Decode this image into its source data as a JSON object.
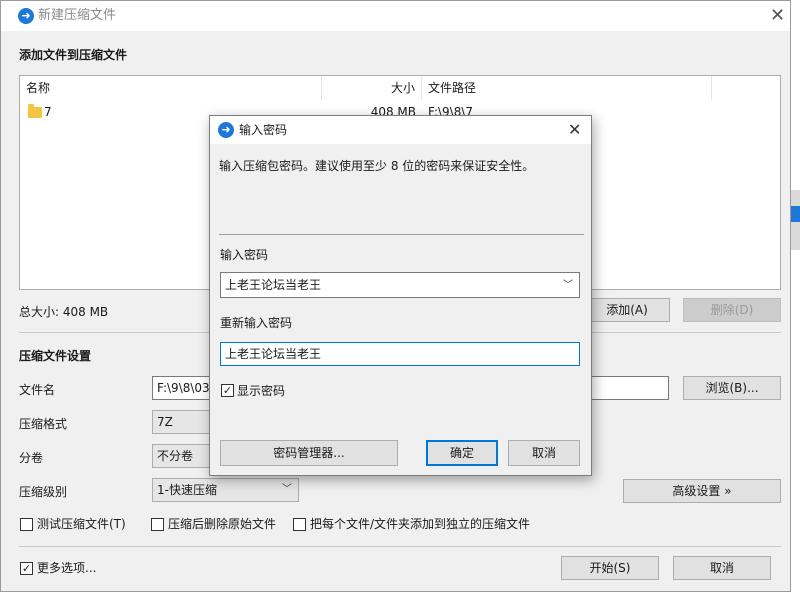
{
  "main": {
    "title": "新建压缩文件",
    "add_section_title": "添加文件到压缩文件",
    "columns": [
      "名称",
      "大小",
      "文件路径"
    ],
    "rows": [
      {
        "name": "7",
        "size": "408 MB",
        "path": "F:\\9\\8\\7"
      }
    ],
    "total_size": "总大小: 408 MB",
    "add_button": "添加(A)",
    "delete_button": "删除(D)",
    "settings_title": "压缩文件设置",
    "filename_label": "文件名",
    "filename_value": "F:\\9\\8\\03",
    "browse_button": "浏览(B)...",
    "format_label": "压缩格式",
    "format_value": "7Z",
    "split_label": "分卷",
    "split_value": "不分卷",
    "level_label": "压缩级别",
    "level_value": "1-快速压缩",
    "advanced_button": "高级设置 »",
    "checkboxes": [
      {
        "label": "测试压缩文件(T)",
        "checked": false
      },
      {
        "label": "压缩后删除原始文件",
        "checked": false
      },
      {
        "label": "把每个文件/文件夹添加到独立的压缩文件",
        "checked": false
      }
    ],
    "more_options": {
      "label": "更多选项...",
      "checked": true
    },
    "start_button": "开始(S)",
    "cancel_button": "取消"
  },
  "dialog": {
    "title": "输入密码",
    "description": "输入压缩包密码。建议使用至少 8 位的密码来保证安全性。",
    "password_label": "输入密码",
    "password_value": "上老王论坛当老王",
    "confirm_label": "重新输入密码",
    "confirm_value": "上老王论坛当老王",
    "show_password": {
      "label": "显示密码",
      "checked": true
    },
    "manager_button": "密码管理器...",
    "ok_button": "确定",
    "cancel_button": "取消"
  },
  "icons": {
    "app": "archive-app-icon",
    "close": "close-icon",
    "folder": "folder-icon",
    "dropdown": "chevron-down-icon",
    "check": "check-icon"
  },
  "colors": {
    "accent": "#0078d7",
    "app_icon": "#1e78d8",
    "folder": "#f5c542"
  }
}
